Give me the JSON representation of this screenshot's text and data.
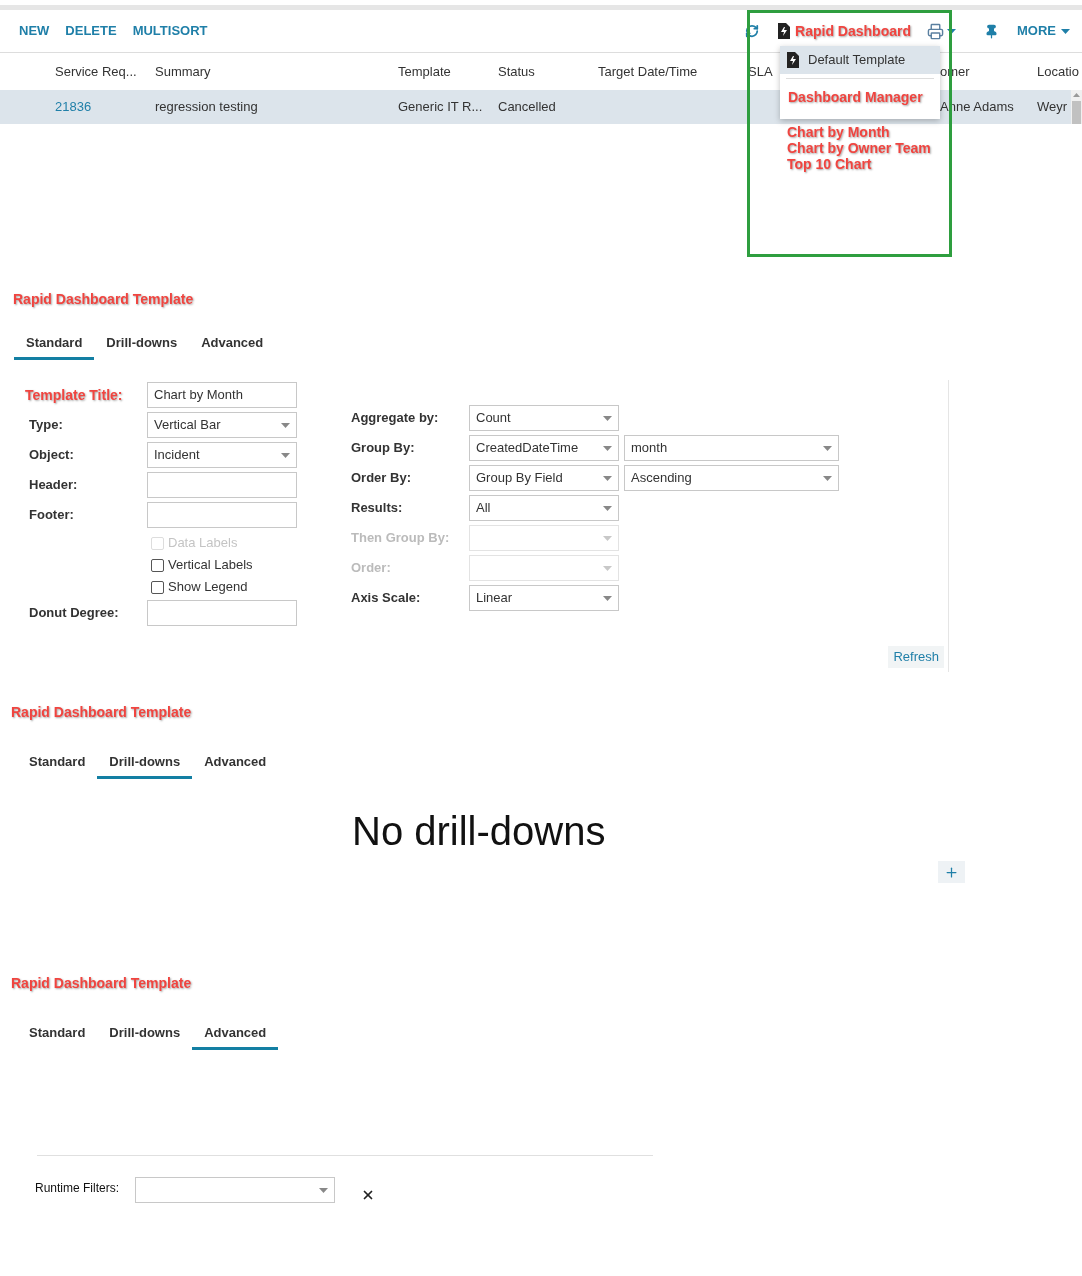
{
  "toolbar": {
    "buttons": [
      "NEW",
      "DELETE",
      "MULTISORT"
    ],
    "dashboard_button": "Rapid Dashboard",
    "more_button": "MORE"
  },
  "dashboard_menu": {
    "items": [
      {
        "label": "Default Template",
        "selected": true,
        "kind": "template"
      },
      {
        "label": "Dashboard Manager",
        "selected": false,
        "kind": "annotated"
      }
    ]
  },
  "annotation_list": [
    "Chart by Month",
    "Chart by Owner Team",
    "Top 10 Chart"
  ],
  "grid": {
    "columns": [
      {
        "label": "Service Req..."
      },
      {
        "label": "Summary"
      },
      {
        "label": "Template"
      },
      {
        "label": "Status"
      },
      {
        "label": "Target Date/Time"
      },
      {
        "label": "SLA"
      },
      {
        "label": "omer"
      },
      {
        "label": "Locatio"
      }
    ],
    "rows": [
      {
        "selected": true,
        "cells": [
          "21836",
          "regression testing",
          "Generic IT R...",
          "Cancelled",
          "",
          "",
          "Anne Adams",
          "Weyr"
        ]
      }
    ]
  },
  "sections": [
    {
      "kind": "standard",
      "title": "Rapid Dashboard Template",
      "tabs": [
        {
          "label": "Standard",
          "selected": true
        },
        {
          "label": "Drill-downs",
          "selected": false
        },
        {
          "label": "Advanced",
          "selected": false
        }
      ],
      "left_fields": [
        {
          "label": "Template Title:",
          "kind": "text",
          "annotated": true,
          "value": "Chart by Month"
        },
        {
          "label": "Type:",
          "kind": "select",
          "annotated": false,
          "value": "Vertical Bar"
        },
        {
          "label": "Object:",
          "kind": "select",
          "annotated": false,
          "value": "Incident"
        },
        {
          "label": "Header:",
          "kind": "text",
          "annotated": false
        },
        {
          "label": "Footer:",
          "kind": "text",
          "annotated": false
        }
      ],
      "checkboxes": [
        {
          "label": "Data Labels",
          "checked": false,
          "disabled": true
        },
        {
          "label": "Vertical Labels",
          "checked": false,
          "disabled": false
        },
        {
          "label": "Show Legend",
          "checked": false,
          "disabled": false
        }
      ],
      "donut_field": {
        "label": "Donut Degree:"
      },
      "right_fields": [
        {
          "label": "Aggregate by:",
          "disabled": false,
          "selects": [
            "Count"
          ]
        },
        {
          "label": "Group By:",
          "disabled": false,
          "selects": [
            "CreatedDateTime",
            "month"
          ]
        },
        {
          "label": "Order By:",
          "disabled": false,
          "selects": [
            "Group By Field",
            "Ascending"
          ]
        },
        {
          "label": "Results:",
          "disabled": false,
          "selects": [
            "All"
          ]
        },
        {
          "label": "Then Group By:",
          "disabled": true
        },
        {
          "label": "Order:",
          "disabled": true
        },
        {
          "label": "Axis Scale:",
          "disabled": false,
          "selects": [
            "Linear"
          ]
        }
      ],
      "refresh_button": "Refresh"
    },
    {
      "kind": "drilldowns",
      "title": "Rapid Dashboard Template",
      "tabs": [
        {
          "label": "Standard",
          "selected": false
        },
        {
          "label": "Drill-downs",
          "selected": true
        },
        {
          "label": "Advanced",
          "selected": false
        }
      ],
      "empty_text": "No drill-downs"
    },
    {
      "kind": "advanced",
      "title": "Rapid Dashboard Template",
      "tabs": [
        {
          "label": "Standard",
          "selected": false
        },
        {
          "label": "Drill-downs",
          "selected": false
        },
        {
          "label": "Advanced",
          "selected": true
        }
      ],
      "runtime_filters": {
        "label": "Runtime Filters:"
      }
    }
  ]
}
